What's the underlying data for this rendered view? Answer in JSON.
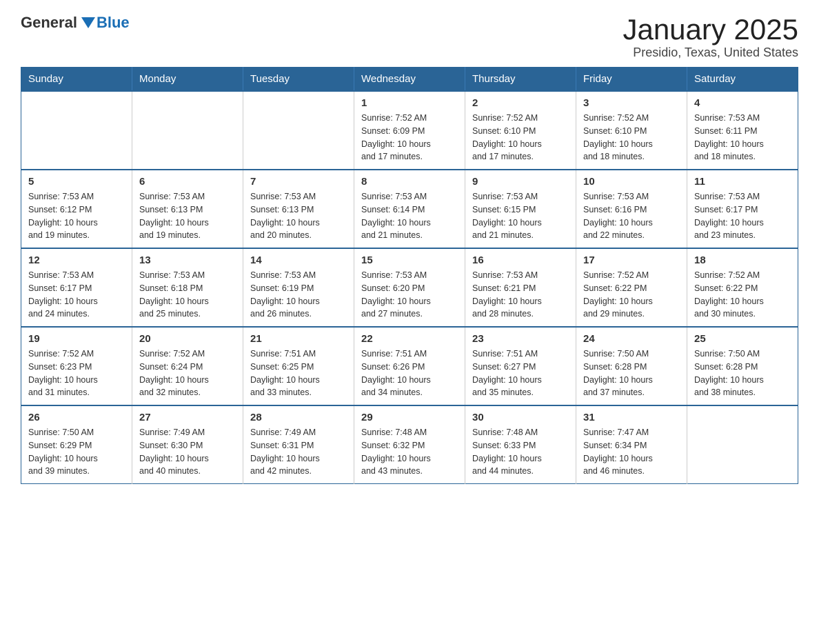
{
  "logo": {
    "general": "General",
    "blue": "Blue"
  },
  "title": "January 2025",
  "subtitle": "Presidio, Texas, United States",
  "days_of_week": [
    "Sunday",
    "Monday",
    "Tuesday",
    "Wednesday",
    "Thursday",
    "Friday",
    "Saturday"
  ],
  "weeks": [
    [
      {
        "day": "",
        "info": ""
      },
      {
        "day": "",
        "info": ""
      },
      {
        "day": "",
        "info": ""
      },
      {
        "day": "1",
        "info": "Sunrise: 7:52 AM\nSunset: 6:09 PM\nDaylight: 10 hours\nand 17 minutes."
      },
      {
        "day": "2",
        "info": "Sunrise: 7:52 AM\nSunset: 6:10 PM\nDaylight: 10 hours\nand 17 minutes."
      },
      {
        "day": "3",
        "info": "Sunrise: 7:52 AM\nSunset: 6:10 PM\nDaylight: 10 hours\nand 18 minutes."
      },
      {
        "day": "4",
        "info": "Sunrise: 7:53 AM\nSunset: 6:11 PM\nDaylight: 10 hours\nand 18 minutes."
      }
    ],
    [
      {
        "day": "5",
        "info": "Sunrise: 7:53 AM\nSunset: 6:12 PM\nDaylight: 10 hours\nand 19 minutes."
      },
      {
        "day": "6",
        "info": "Sunrise: 7:53 AM\nSunset: 6:13 PM\nDaylight: 10 hours\nand 19 minutes."
      },
      {
        "day": "7",
        "info": "Sunrise: 7:53 AM\nSunset: 6:13 PM\nDaylight: 10 hours\nand 20 minutes."
      },
      {
        "day": "8",
        "info": "Sunrise: 7:53 AM\nSunset: 6:14 PM\nDaylight: 10 hours\nand 21 minutes."
      },
      {
        "day": "9",
        "info": "Sunrise: 7:53 AM\nSunset: 6:15 PM\nDaylight: 10 hours\nand 21 minutes."
      },
      {
        "day": "10",
        "info": "Sunrise: 7:53 AM\nSunset: 6:16 PM\nDaylight: 10 hours\nand 22 minutes."
      },
      {
        "day": "11",
        "info": "Sunrise: 7:53 AM\nSunset: 6:17 PM\nDaylight: 10 hours\nand 23 minutes."
      }
    ],
    [
      {
        "day": "12",
        "info": "Sunrise: 7:53 AM\nSunset: 6:17 PM\nDaylight: 10 hours\nand 24 minutes."
      },
      {
        "day": "13",
        "info": "Sunrise: 7:53 AM\nSunset: 6:18 PM\nDaylight: 10 hours\nand 25 minutes."
      },
      {
        "day": "14",
        "info": "Sunrise: 7:53 AM\nSunset: 6:19 PM\nDaylight: 10 hours\nand 26 minutes."
      },
      {
        "day": "15",
        "info": "Sunrise: 7:53 AM\nSunset: 6:20 PM\nDaylight: 10 hours\nand 27 minutes."
      },
      {
        "day": "16",
        "info": "Sunrise: 7:53 AM\nSunset: 6:21 PM\nDaylight: 10 hours\nand 28 minutes."
      },
      {
        "day": "17",
        "info": "Sunrise: 7:52 AM\nSunset: 6:22 PM\nDaylight: 10 hours\nand 29 minutes."
      },
      {
        "day": "18",
        "info": "Sunrise: 7:52 AM\nSunset: 6:22 PM\nDaylight: 10 hours\nand 30 minutes."
      }
    ],
    [
      {
        "day": "19",
        "info": "Sunrise: 7:52 AM\nSunset: 6:23 PM\nDaylight: 10 hours\nand 31 minutes."
      },
      {
        "day": "20",
        "info": "Sunrise: 7:52 AM\nSunset: 6:24 PM\nDaylight: 10 hours\nand 32 minutes."
      },
      {
        "day": "21",
        "info": "Sunrise: 7:51 AM\nSunset: 6:25 PM\nDaylight: 10 hours\nand 33 minutes."
      },
      {
        "day": "22",
        "info": "Sunrise: 7:51 AM\nSunset: 6:26 PM\nDaylight: 10 hours\nand 34 minutes."
      },
      {
        "day": "23",
        "info": "Sunrise: 7:51 AM\nSunset: 6:27 PM\nDaylight: 10 hours\nand 35 minutes."
      },
      {
        "day": "24",
        "info": "Sunrise: 7:50 AM\nSunset: 6:28 PM\nDaylight: 10 hours\nand 37 minutes."
      },
      {
        "day": "25",
        "info": "Sunrise: 7:50 AM\nSunset: 6:28 PM\nDaylight: 10 hours\nand 38 minutes."
      }
    ],
    [
      {
        "day": "26",
        "info": "Sunrise: 7:50 AM\nSunset: 6:29 PM\nDaylight: 10 hours\nand 39 minutes."
      },
      {
        "day": "27",
        "info": "Sunrise: 7:49 AM\nSunset: 6:30 PM\nDaylight: 10 hours\nand 40 minutes."
      },
      {
        "day": "28",
        "info": "Sunrise: 7:49 AM\nSunset: 6:31 PM\nDaylight: 10 hours\nand 42 minutes."
      },
      {
        "day": "29",
        "info": "Sunrise: 7:48 AM\nSunset: 6:32 PM\nDaylight: 10 hours\nand 43 minutes."
      },
      {
        "day": "30",
        "info": "Sunrise: 7:48 AM\nSunset: 6:33 PM\nDaylight: 10 hours\nand 44 minutes."
      },
      {
        "day": "31",
        "info": "Sunrise: 7:47 AM\nSunset: 6:34 PM\nDaylight: 10 hours\nand 46 minutes."
      },
      {
        "day": "",
        "info": ""
      }
    ]
  ]
}
